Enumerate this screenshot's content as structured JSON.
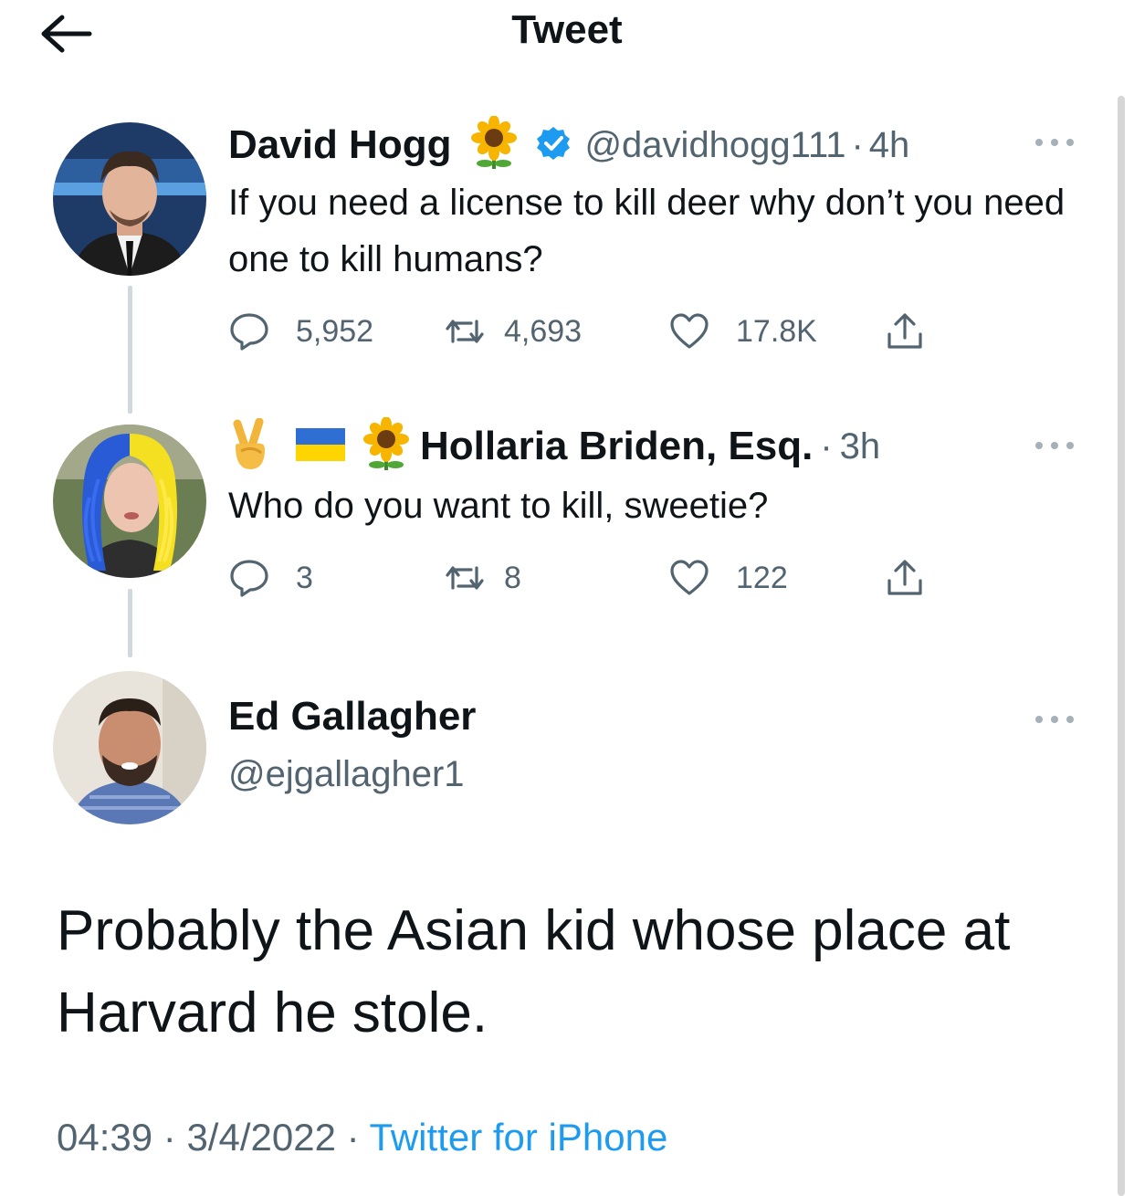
{
  "header": {
    "title": "Tweet",
    "back_icon": "arrow-left-icon"
  },
  "colors": {
    "accent": "#1d9bf0",
    "text": "#0f1419",
    "muted": "#536471",
    "line": "#cfd9de"
  },
  "thread": [
    {
      "name": "David Hogg",
      "handle": "@davidhogg111",
      "separator": "·",
      "time": "4h",
      "verified": true,
      "name_emoji": "sunflower-icon",
      "text": "If you need a license to kill deer why don’t you need one to kill humans?",
      "stats": {
        "replies": "5,952",
        "retweets": "4,693",
        "likes": "17.8K"
      }
    },
    {
      "name": "Hollaria Briden, Esq.",
      "separator": "·",
      "time": "3h",
      "name_emojis": [
        "victory-hand-icon",
        "ukraine-flag-icon",
        "sunflower-icon"
      ],
      "text": "Who do you want to kill, sweetie?",
      "stats": {
        "replies": "3",
        "retweets": "8",
        "likes": "122"
      }
    }
  ],
  "main_tweet": {
    "name": "Ed Gallagher",
    "handle": "@ejgallagher1",
    "text": "Probably the Asian kid whose place at Harvard he stole.",
    "time": "04:39",
    "sep1": " · ",
    "date": "3/4/2022",
    "sep2": " · ",
    "source": "Twitter for iPhone"
  }
}
